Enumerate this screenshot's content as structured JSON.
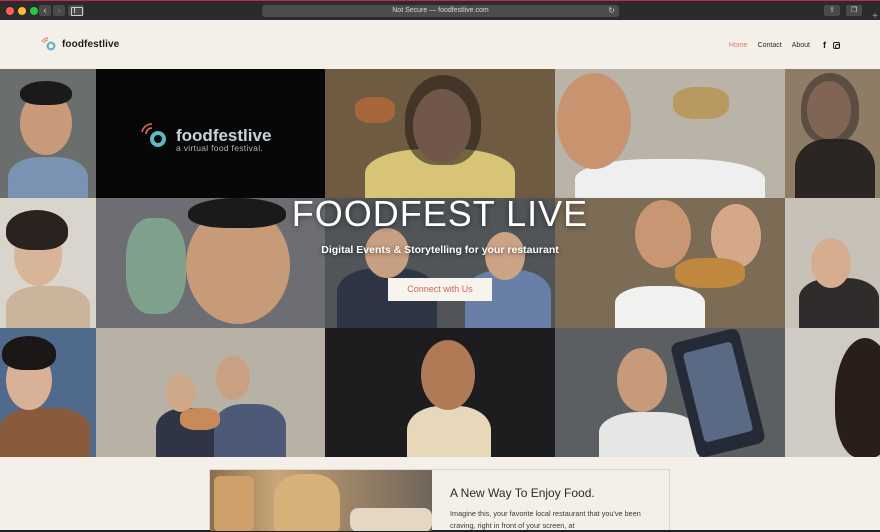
{
  "browser": {
    "url_text": "Not Secure — foodfestlive.com",
    "back_icon": "chevron-left-icon",
    "forward_icon": "chevron-right-icon",
    "reload_icon": "reload-icon",
    "share_icon": "share-icon",
    "tabs_icon": "tabs-icon",
    "new_tab_icon": "plus-icon"
  },
  "site": {
    "logo_text": "foodfestlive",
    "nav": [
      {
        "label": "Home",
        "active": true
      },
      {
        "label": "Contact",
        "active": false
      },
      {
        "label": "About",
        "active": false
      }
    ],
    "social_icons": [
      "facebook-icon",
      "instagram-icon"
    ]
  },
  "hero": {
    "title": "FOODFEST LIVE",
    "subtitle": "Digital Events & Storytelling for your restaurant",
    "cta_label": "Connect with Us",
    "tile_logo_text": "foodfestlive",
    "tile_logo_tagline": "a virtual food festival."
  },
  "intro": {
    "title": "A New Way To Enjoy Food.",
    "text": "Imagine this, your favorite local restaurant that you've been craving, right in front of your screen, at"
  },
  "colors": {
    "accent": "#d2655a",
    "nav_active": "#d97a6b",
    "background": "#f4f0e9"
  }
}
